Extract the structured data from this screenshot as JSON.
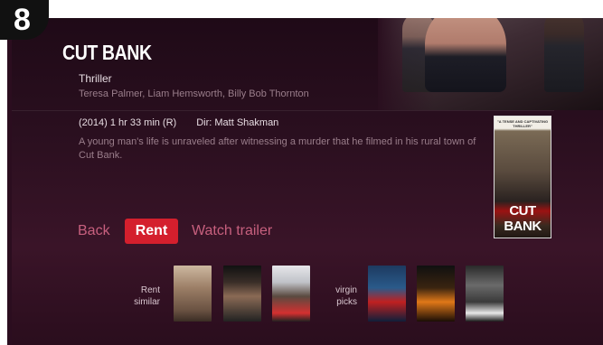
{
  "badge": "8",
  "movie": {
    "title": "CUT BANK",
    "genre": "Thriller",
    "cast": "Teresa Palmer, Liam Hemsworth, Billy Bob Thornton",
    "meta": "(2014) 1 hr 33 min (R)",
    "director": "Dir: Matt Shakman",
    "description": "A young man's life is unraveled after witnessing a murder that he filmed in his rural town of Cut Bank.",
    "poster_tagline": "\"A TENSE AND CAPTIVATING THRILLER\"",
    "poster_title": "CUT BANK"
  },
  "actions": {
    "back": "Back",
    "rent": "Rent",
    "trailer": "Watch trailer"
  },
  "rows": {
    "rent_similar_line1": "Rent",
    "rent_similar_line2": "similar",
    "virgin_picks_line1": "virgin",
    "virgin_picks_line2": "picks"
  },
  "colors": {
    "accent_red": "#d41f2d",
    "link_pink": "#c7607e"
  }
}
